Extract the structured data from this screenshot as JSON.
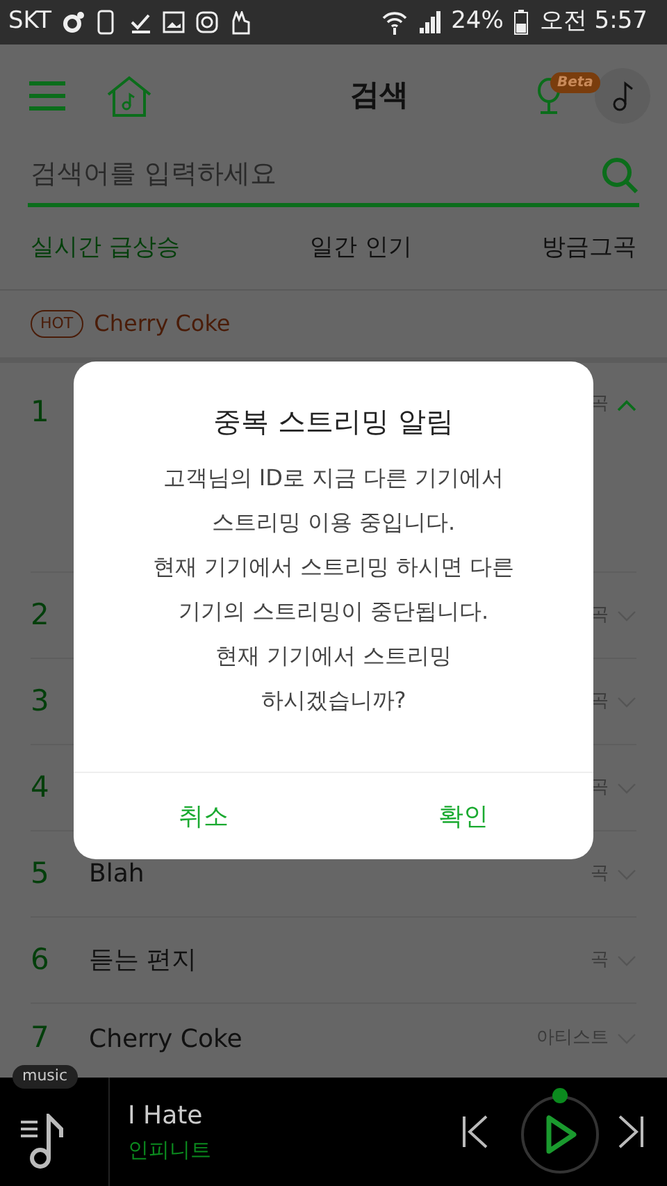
{
  "status_bar": {
    "carrier": "SKT",
    "battery": "24%",
    "time": "오전 5:57"
  },
  "header": {
    "title": "검색",
    "beta_badge": "Beta"
  },
  "search": {
    "placeholder": "검색어를 입력하세요"
  },
  "tabs": [
    {
      "label": "실시간 급상승",
      "selected": true
    },
    {
      "label": "일간 인기",
      "selected": false
    },
    {
      "label": "방금그곡",
      "selected": false
    }
  ],
  "hot": {
    "badge": "HOT",
    "keyword": "Cherry Coke"
  },
  "ranking": [
    {
      "rank": "1",
      "type": "곡",
      "expanded": true
    },
    {
      "rank": "2",
      "type": "곡",
      "expanded": false
    },
    {
      "rank": "3",
      "type": "곡",
      "expanded": false
    },
    {
      "rank": "4",
      "type": "곡",
      "expanded": false
    },
    {
      "rank": "5",
      "title": "Blah",
      "type": "곡",
      "expanded": false
    },
    {
      "rank": "6",
      "title": "듣는 편지",
      "type": "곡",
      "expanded": false
    },
    {
      "rank": "7",
      "title": "Cherry Coke",
      "type": "아티스트",
      "expanded": false
    }
  ],
  "dialog": {
    "title": "중복 스트리밍 알림",
    "message": "고객님의 ID로 지금 다른 기기에서\n스트리밍 이용 중입니다.\n현재 기기에서 스트리밍 하시면 다른\n기기의 스트리밍이 중단됩니다.\n현재 기기에서 스트리밍\n하시겠습니까?",
    "buttons": [
      "취소",
      "확인"
    ]
  },
  "player": {
    "badge": "music",
    "song": "I Hate",
    "artist": "인피니트"
  }
}
